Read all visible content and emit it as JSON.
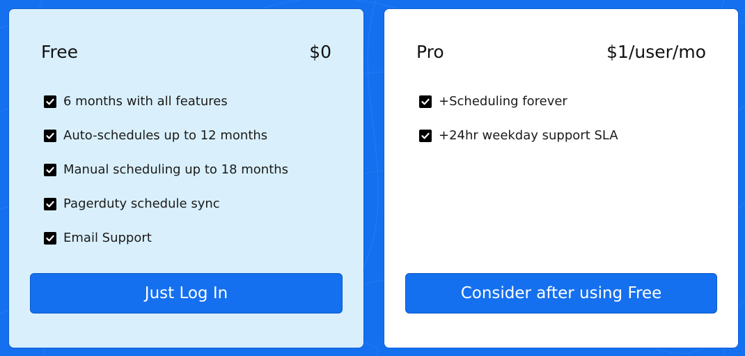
{
  "colors": {
    "background": "#1570ef",
    "free_card": "#d9f0fc",
    "pro_card": "#ffffff",
    "button": "#1570ef",
    "check": "#000000"
  },
  "plans": [
    {
      "name": "Free",
      "price": "$0",
      "features": [
        "6 months with all features",
        "Auto-schedules up to 12 months",
        "Manual scheduling up to 18 months",
        "Pagerduty schedule sync",
        "Email Support"
      ],
      "button": "Just Log In"
    },
    {
      "name": "Pro",
      "price": "$1/user/mo",
      "features": [
        "+Scheduling forever",
        "+24hr weekday support SLA"
      ],
      "button": "Consider after using Free"
    }
  ],
  "icons": {
    "feature_bullet": "checkbox-checked-icon"
  }
}
